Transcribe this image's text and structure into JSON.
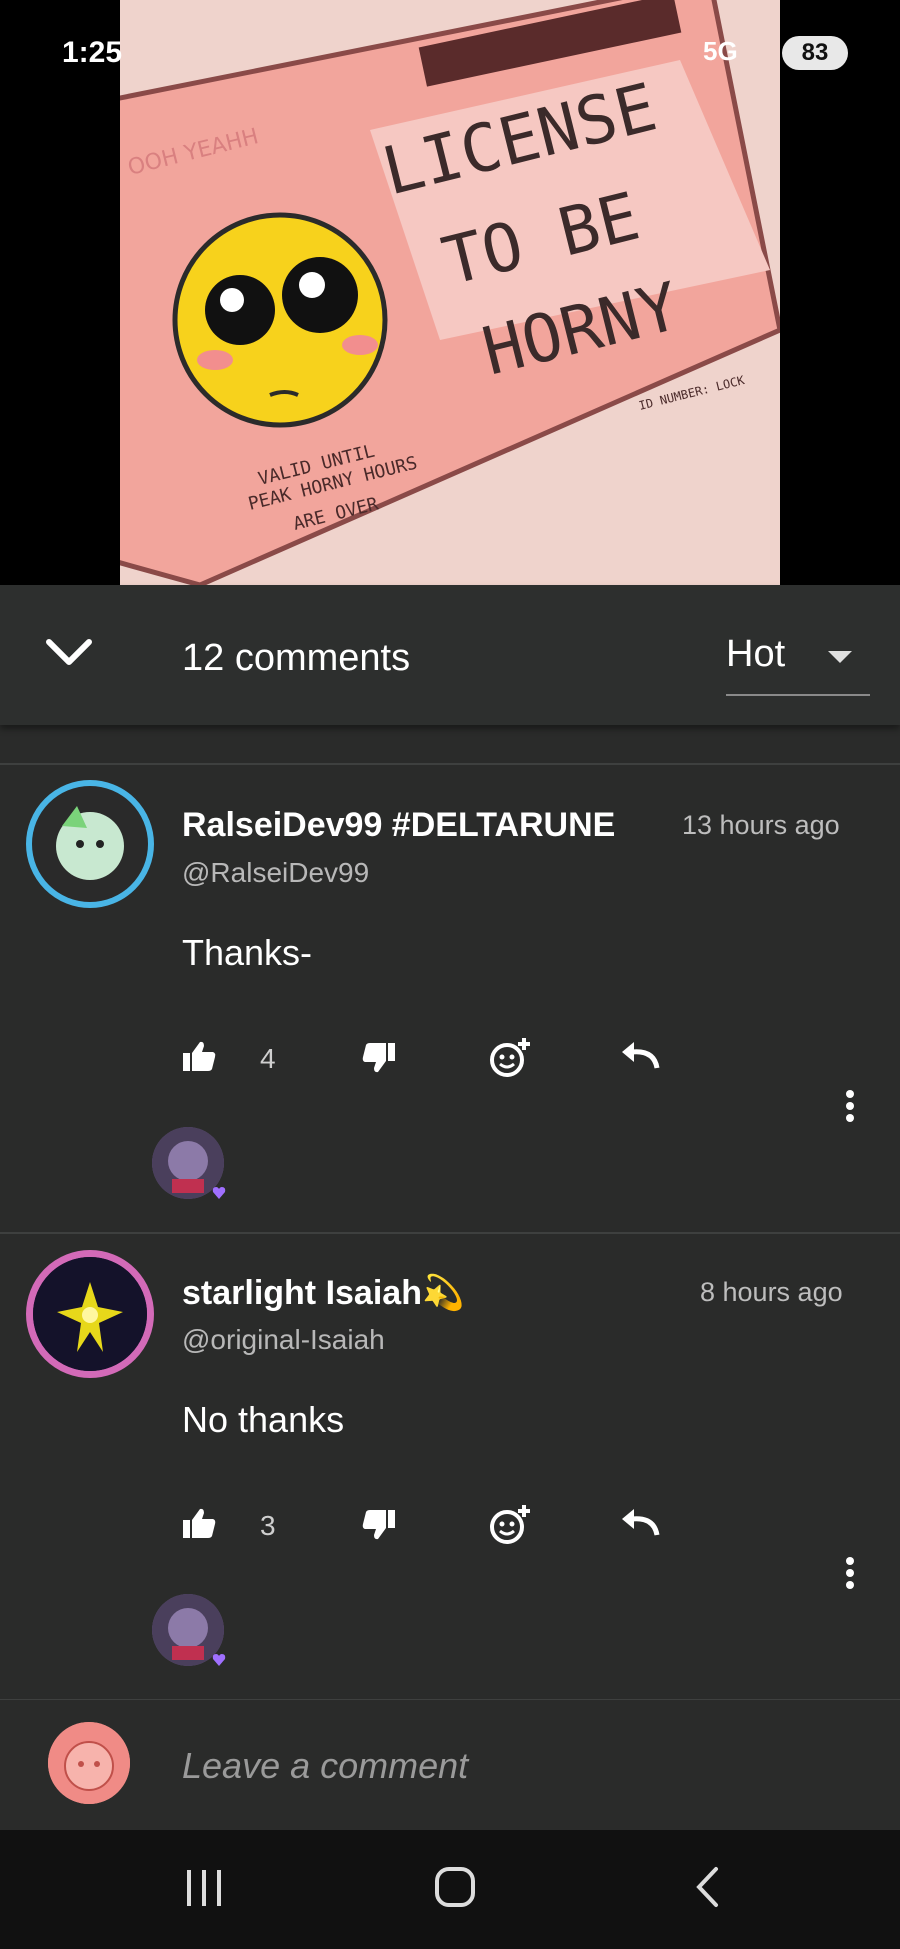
{
  "status_bar": {
    "time": "1:25",
    "network": "5G",
    "battery": "83"
  },
  "media": {
    "title_lines": [
      "LICENSE",
      "TO BE",
      "HORNY"
    ],
    "stamp": "OOH YEAHH",
    "valid_text": [
      "VALID UNTIL",
      "PEAK HORNY HOURS",
      "ARE OVER"
    ],
    "id_number": "ID NUMBER: LOCK"
  },
  "header": {
    "comments_count": "12 comments",
    "sort": "Hot"
  },
  "comments": [
    {
      "username": "RalseiDev99 #DELTARUNE",
      "handle": "@RalseiDev99",
      "time": "13 hours ago",
      "text": "Thanks-",
      "likes": "4"
    },
    {
      "username": "starlight Isaiah💫",
      "handle": "@original-Isaiah",
      "time": "8 hours ago",
      "text": "No thanks",
      "likes": "3"
    }
  ],
  "composer": {
    "placeholder": "Leave a comment"
  },
  "icons": {
    "collapse": "chevron-down-icon",
    "sort": "caret-down-icon",
    "like": "thumbs-up-icon",
    "dislike": "thumbs-down-icon",
    "react": "add-reaction-icon",
    "reply": "reply-icon",
    "more": "more-vertical-icon"
  },
  "colors": {
    "background": "#2a2b2a",
    "header": "#2d2f2e",
    "accent_purple": "#a070ff"
  }
}
